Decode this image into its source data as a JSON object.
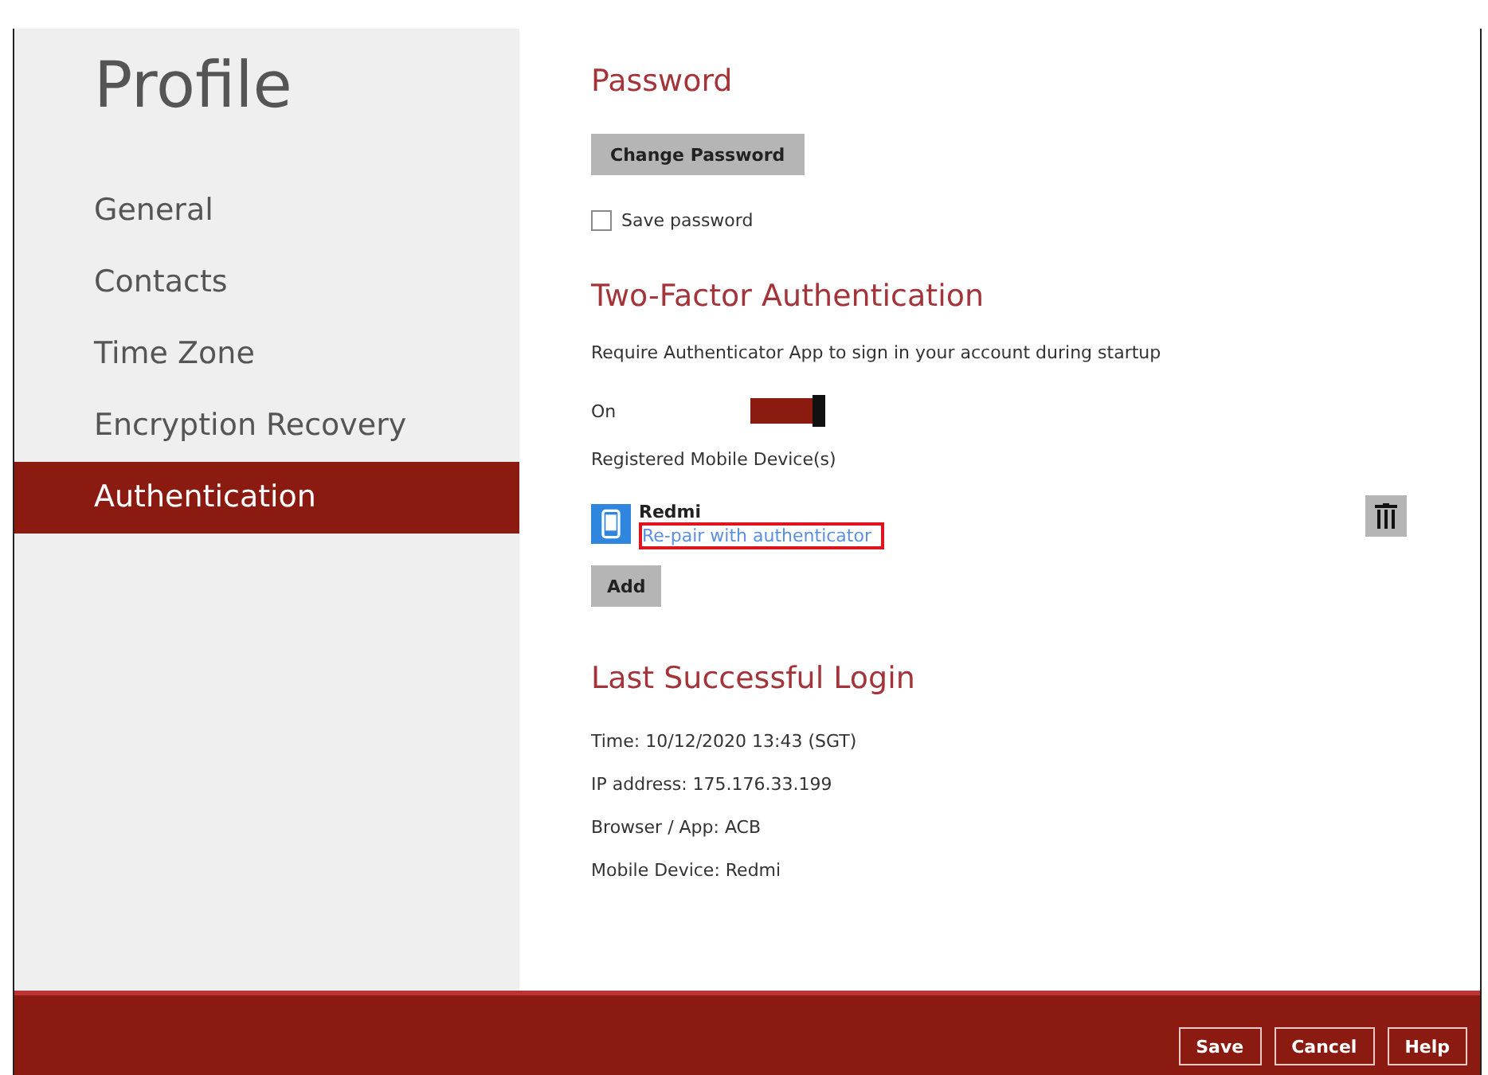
{
  "sidebar": {
    "title": "Profile",
    "items": [
      {
        "label": "General",
        "selected": false
      },
      {
        "label": "Contacts",
        "selected": false
      },
      {
        "label": "Time Zone",
        "selected": false
      },
      {
        "label": "Encryption Recovery",
        "selected": false
      },
      {
        "label": "Authentication",
        "selected": true
      }
    ]
  },
  "password": {
    "heading": "Password",
    "button": "Change Password",
    "save_password": {
      "label": "Save password",
      "checked": false
    }
  },
  "two_factor": {
    "heading": "Two-Factor Authentication",
    "description": "Require Authenticator App to sign in your account during startup",
    "toggle": {
      "label": "On",
      "on": true
    },
    "devices_label": "Registered Mobile Device(s)",
    "devices": [
      {
        "name": "Redmi",
        "link": "Re-pair with authenticator",
        "highlighted": true
      }
    ],
    "add_button": "Add"
  },
  "last_login": {
    "heading": "Last Successful Login",
    "lines": [
      "Time: 10/12/2020 13:43 (SGT)",
      "IP address: 175.176.33.199",
      "Browser / App: ACB",
      "Mobile Device: Redmi"
    ]
  },
  "footer": {
    "buttons": [
      "Save",
      "Cancel",
      "Help"
    ]
  }
}
